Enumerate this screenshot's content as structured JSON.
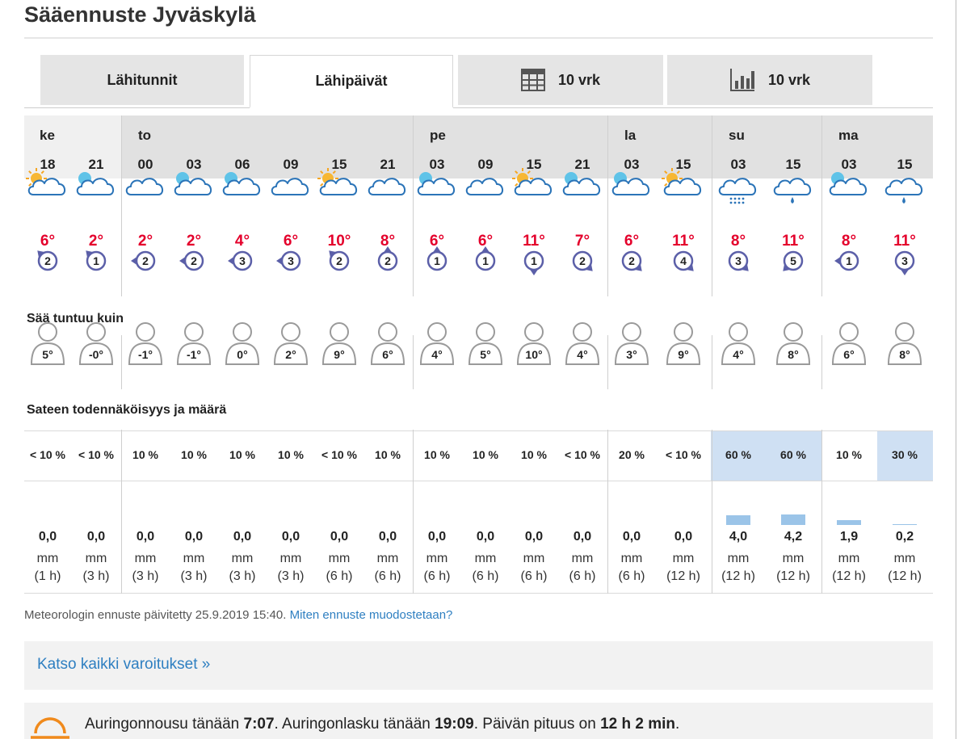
{
  "page": {
    "title": "Sääennuste Jyväskylä"
  },
  "tabs": [
    {
      "label": "Lähitunnit",
      "active": false,
      "icon": null
    },
    {
      "label": "Lähipäivät",
      "active": true,
      "icon": null
    },
    {
      "label": "10 vrk",
      "active": false,
      "icon": "calendar-table-icon"
    },
    {
      "label": "10 vrk",
      "active": false,
      "icon": "bar-chart-icon"
    }
  ],
  "days": [
    "ke",
    "to",
    "pe",
    "la",
    "su",
    "ma"
  ],
  "columns": [
    {
      "hour": "18",
      "icon": "partly-sunny-icon",
      "temp": "6°",
      "wind_speed": "2",
      "wind_dir": "north-west",
      "feels": "5°",
      "precip_prob": "< 10 %",
      "amount": "0,0",
      "unit": "mm",
      "period": "(1 h)",
      "bar_mm": 0
    },
    {
      "hour": "21",
      "icon": "cloudy-night-icon",
      "temp": "2°",
      "wind_speed": "1",
      "wind_dir": "north-west",
      "feels": "-0°",
      "precip_prob": "< 10 %",
      "amount": "0,0",
      "unit": "mm",
      "period": "(3 h)",
      "bar_mm": 0
    },
    {
      "hour": "00",
      "icon": "cloudy-icon",
      "temp": "2°",
      "wind_speed": "2",
      "wind_dir": "west",
      "feels": "-1°",
      "precip_prob": "10 %",
      "amount": "0,0",
      "unit": "mm",
      "period": "(3 h)",
      "bar_mm": 0
    },
    {
      "hour": "03",
      "icon": "cloudy-night-icon",
      "temp": "2°",
      "wind_speed": "2",
      "wind_dir": "west",
      "feels": "-1°",
      "precip_prob": "10 %",
      "amount": "0,0",
      "unit": "mm",
      "period": "(3 h)",
      "bar_mm": 0
    },
    {
      "hour": "06",
      "icon": "partly-cloudy-night-icon",
      "temp": "4°",
      "wind_speed": "3",
      "wind_dir": "west",
      "feels": "0°",
      "precip_prob": "10 %",
      "amount": "0,0",
      "unit": "mm",
      "period": "(3 h)",
      "bar_mm": 0
    },
    {
      "hour": "09",
      "icon": "cloudy-icon",
      "temp": "6°",
      "wind_speed": "3",
      "wind_dir": "west",
      "feels": "2°",
      "precip_prob": "10 %",
      "amount": "0,0",
      "unit": "mm",
      "period": "(3 h)",
      "bar_mm": 0
    },
    {
      "hour": "15",
      "icon": "partly-sunny-icon",
      "temp": "10°",
      "wind_speed": "2",
      "wind_dir": "north-west",
      "feels": "9°",
      "precip_prob": "< 10 %",
      "amount": "0,0",
      "unit": "mm",
      "period": "(6 h)",
      "bar_mm": 0
    },
    {
      "hour": "21",
      "icon": "cloudy-icon",
      "temp": "8°",
      "wind_speed": "2",
      "wind_dir": "north",
      "feels": "6°",
      "precip_prob": "10 %",
      "amount": "0,0",
      "unit": "mm",
      "period": "(6 h)",
      "bar_mm": 0
    },
    {
      "hour": "03",
      "icon": "partly-cloudy-night-icon",
      "temp": "6°",
      "wind_speed": "1",
      "wind_dir": "north",
      "feels": "4°",
      "precip_prob": "10 %",
      "amount": "0,0",
      "unit": "mm",
      "period": "(6 h)",
      "bar_mm": 0
    },
    {
      "hour": "09",
      "icon": "cloudy-icon",
      "temp": "6°",
      "wind_speed": "1",
      "wind_dir": "north",
      "feels": "5°",
      "precip_prob": "10 %",
      "amount": "0,0",
      "unit": "mm",
      "period": "(6 h)",
      "bar_mm": 0
    },
    {
      "hour": "15",
      "icon": "partly-sunny-icon",
      "temp": "11°",
      "wind_speed": "1",
      "wind_dir": "south",
      "feels": "10°",
      "precip_prob": "10 %",
      "amount": "0,0",
      "unit": "mm",
      "period": "(6 h)",
      "bar_mm": 0
    },
    {
      "hour": "21",
      "icon": "partly-cloudy-night-icon",
      "temp": "7°",
      "wind_speed": "2",
      "wind_dir": "south-east",
      "feels": "4°",
      "precip_prob": "< 10 %",
      "amount": "0,0",
      "unit": "mm",
      "period": "(6 h)",
      "bar_mm": 0
    },
    {
      "hour": "03",
      "icon": "partly-cloudy-night-icon",
      "temp": "6°",
      "wind_speed": "2",
      "wind_dir": "south-east",
      "feels": "3°",
      "precip_prob": "20 %",
      "amount": "0,0",
      "unit": "mm",
      "period": "(6 h)",
      "bar_mm": 0
    },
    {
      "hour": "15",
      "icon": "partly-sunny-icon",
      "temp": "11°",
      "wind_speed": "4",
      "wind_dir": "south-east",
      "feels": "9°",
      "precip_prob": "< 10 %",
      "amount": "0,0",
      "unit": "mm",
      "period": "(12 h)",
      "bar_mm": 0
    },
    {
      "hour": "03",
      "icon": "snow-cloud-icon",
      "temp": "8°",
      "wind_speed": "3",
      "wind_dir": "south-east",
      "feels": "4°",
      "precip_prob": "60 %",
      "amount": "4,0",
      "unit": "mm",
      "period": "(12 h)",
      "bar_mm": 4.0
    },
    {
      "hour": "15",
      "icon": "rain-cloud-icon",
      "temp": "11°",
      "wind_speed": "5",
      "wind_dir": "south-west",
      "feels": "8°",
      "precip_prob": "60 %",
      "amount": "4,2",
      "unit": "mm",
      "period": "(12 h)",
      "bar_mm": 4.2
    },
    {
      "hour": "03",
      "icon": "partly-cloudy-night-icon",
      "temp": "8°",
      "wind_speed": "1",
      "wind_dir": "west",
      "feels": "6°",
      "precip_prob": "10 %",
      "amount": "1,9",
      "unit": "mm",
      "period": "(12 h)",
      "bar_mm": 1.9
    },
    {
      "hour": "15",
      "icon": "rain-cloud-icon",
      "temp": "11°",
      "wind_speed": "3",
      "wind_dir": "south",
      "feels": "8°",
      "precip_prob": "30 %",
      "amount": "0,2",
      "unit": "mm",
      "period": "(12 h)",
      "bar_mm": 0.2
    }
  ],
  "sections": {
    "feels_like": "Sää tuntuu kuin",
    "precipitation": "Sateen todennäköisyys ja määrä"
  },
  "footer": {
    "updated": "Meteorologin ennuste päivitetty 25.9.2019 15:40.",
    "link": "Miten ennuste muodostetaan?"
  },
  "warnings": {
    "link": "Katso kaikki varoitukset »"
  },
  "sun": {
    "t1": "Auringonnousu tänään ",
    "rise": "7:07",
    "t2": ". Auringonlasku tänään ",
    "set": "19:09",
    "t3": ". Päivän pituus on ",
    "length": "12 h 2 min",
    "t4": "."
  },
  "colors": {
    "temp": "#e4002b",
    "link": "#2e7fc1",
    "wind": "#5b5fa8",
    "highlight": "#cfe0f3",
    "sun": "#f08a1c"
  }
}
